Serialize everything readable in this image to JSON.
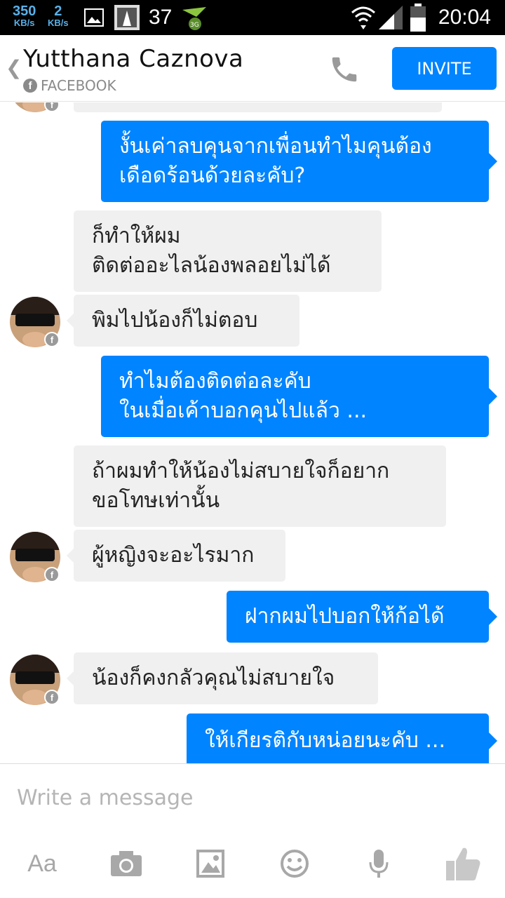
{
  "status_bar": {
    "net_down": "350",
    "net_down_unit": "KB/s",
    "net_up": "2",
    "net_up_unit": "KB/s",
    "notification_count": "37",
    "time": "20:04",
    "icons": [
      "image-icon",
      "app-icon",
      "3g-icon",
      "wifi-icon",
      "signal-icon",
      "battery-icon"
    ]
  },
  "header": {
    "back_icon": "chevron-left-icon",
    "contact_name": "Yutthana Caznova",
    "source": "FACEBOOK",
    "call_icon": "phone-icon",
    "invite_label": "INVITE"
  },
  "messages": [
    {
      "from": "me",
      "lines": [
        "งั้นเค่าลบคุนจากเพื่อนทำไมคุนต้อง",
        "เดือดร้อนด้วยละคับ?"
      ]
    },
    {
      "from": "them",
      "lines": [
        "ก็ทำให้ผม",
        "ติดต่ออะไลน้องพลอยไม่ได้"
      ]
    },
    {
      "from": "them",
      "lines": [
        "พิมไปน้องก็ไม่ตอบ"
      ]
    },
    {
      "from": "me",
      "lines": [
        "ทำไมต้องติดต่อละคับ",
        "ในเมื่อเค้าบอกคุนไปแล้ว ..."
      ]
    },
    {
      "from": "them",
      "lines": [
        "ถ้าผมทำให้น้องไม่สบายใจก็อยาก",
        "ขอโทษเท่านั้น"
      ]
    },
    {
      "from": "them",
      "lines": [
        "ผู้หญิงจะอะไรมาก"
      ]
    },
    {
      "from": "me",
      "lines": [
        "ฝากผมไปบอกให้ก้อได้"
      ]
    },
    {
      "from": "them",
      "lines": [
        "น้องก็คงกลัวคุณไม่สบายใจ"
      ]
    },
    {
      "from": "me",
      "lines": [
        "ให้เกียรติกับหน่อยนะคับ ..."
      ]
    }
  ],
  "composer": {
    "placeholder": "Write a message",
    "font_label": "Aa",
    "tools": [
      "font-icon",
      "camera-icon",
      "gallery-icon",
      "emoji-icon",
      "microphone-icon",
      "like-icon"
    ]
  },
  "colors": {
    "accent": "#0084ff",
    "incoming_bubble": "#f0f0f0",
    "status_bar": "#000000"
  }
}
